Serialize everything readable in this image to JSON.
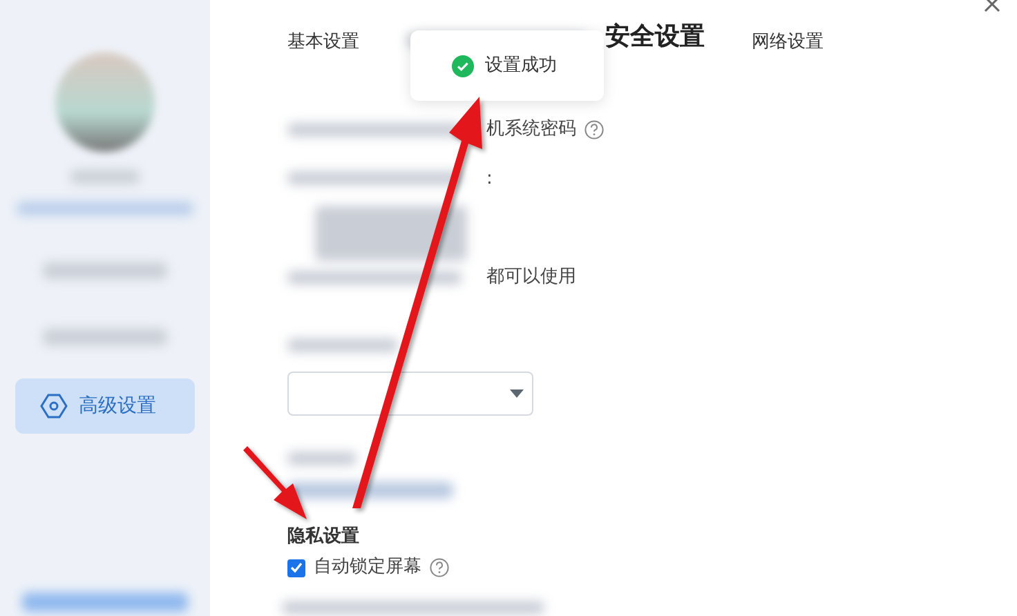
{
  "sidebar": {
    "items": [
      {
        "label": "高级设置",
        "selected": true
      }
    ]
  },
  "tabs": [
    {
      "label": "基本设置",
      "selected": false
    },
    {
      "label": "安全设置",
      "selected": true
    },
    {
      "label": "网络设置",
      "selected": false
    }
  ],
  "toast": {
    "text": "设置成功"
  },
  "fragments": [
    {
      "text": "机系统密码",
      "help": true
    },
    {
      "text": ":",
      "help": false
    },
    {
      "text": "都可以使用",
      "help": false
    }
  ],
  "privacy": {
    "title": "隐私设置",
    "options": [
      {
        "label": "自动锁定屏幕",
        "checked": true,
        "help": true
      }
    ]
  }
}
